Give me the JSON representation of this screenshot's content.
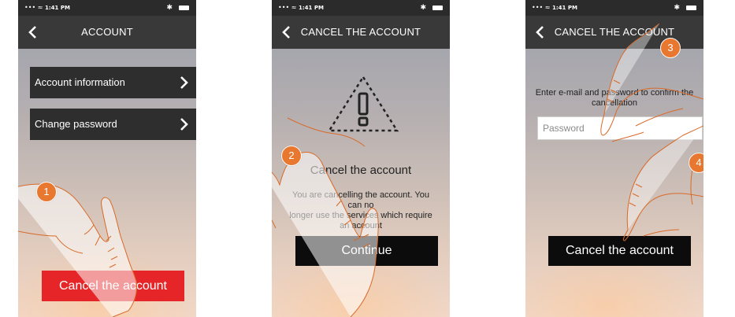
{
  "status_bar": {
    "signal": "••• ≈",
    "time": "1:41 PM",
    "bluetooth": "✱"
  },
  "screen1": {
    "nav_title": "ACCOUNT",
    "menu_items": [
      {
        "label": "Account information"
      },
      {
        "label": "Change password"
      }
    ],
    "cancel_button": "Cancel the account",
    "step_badge": "1"
  },
  "screen2": {
    "nav_title": "CANCEL THE ACCOUNT",
    "heading": "Cancel the account",
    "body_line1": "You are cancelling the account. You can no",
    "body_line2": "longer use the services which require",
    "body_line3": "an account",
    "continue_button": "Continue",
    "step_badge": "2"
  },
  "screen3": {
    "nav_title": "CANCEL THE ACCOUNT",
    "instructions_line1": "Enter e-mail and password to confirm the",
    "instructions_line2": "cancellation",
    "password_placeholder": "Password",
    "cancel_button": "Cancel the account",
    "step_badges": [
      "3",
      "4"
    ]
  },
  "colors": {
    "nav_bg": "#393939",
    "accent_red": "#e52528",
    "badge_orange": "#e8782f",
    "dark_button": "#0c0c0c",
    "hand_stroke": "#d86a28"
  },
  "icons": [
    "back-chevron-icon",
    "chevron-right-icon",
    "warning-triangle-icon",
    "pointing-hand-icon",
    "wifi-icon",
    "bluetooth-icon",
    "battery-icon"
  ]
}
